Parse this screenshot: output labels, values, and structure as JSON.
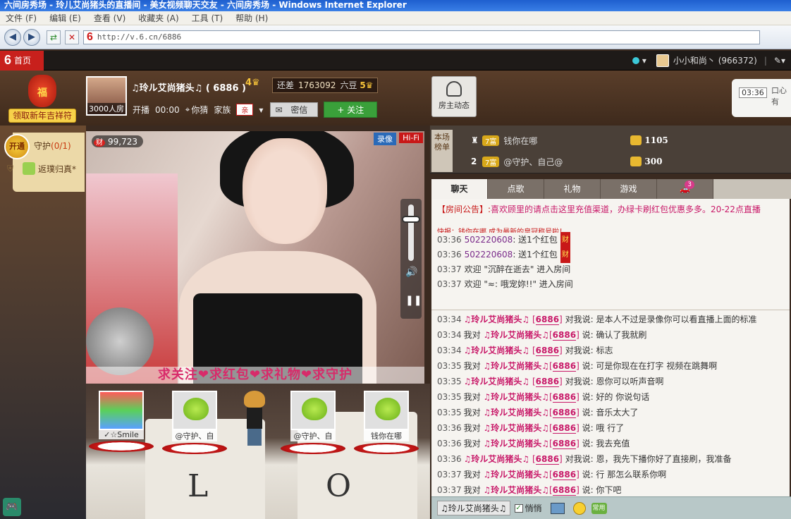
{
  "window": {
    "title": "六间房秀场 - 玲儿艾尚猪头的直播间 - 美女视频聊天交友 - 六间房秀场 - Windows Internet Explorer"
  },
  "menu": [
    "文件 (F)",
    "编辑 (E)",
    "查看 (V)",
    "收藏夹 (A)",
    "工具 (T)",
    "帮助 (H)"
  ],
  "address": {
    "url": "http://v.6.cn/6886",
    "logo": "6"
  },
  "site": {
    "home_logo": "6",
    "home_label": "首页",
    "user": "小小和尚丶 (966372)",
    "separator": "|"
  },
  "header": {
    "newyear_label": "领取新年吉祥符",
    "fu_char": "福",
    "host_photo_caption": "3000人房",
    "host_name": "♫玲ル艾尚猪头♫ ( 6886 )",
    "host_level": "4",
    "gap_label": "还差",
    "gap_value": "1763092",
    "gap_unit": "六豆",
    "next_level": "5",
    "live_label": "开播",
    "live_time": "00:00",
    "location": "你猜",
    "family_label": "家族",
    "family_badge": "亲",
    "message_button": "密信",
    "follow_button": "+ 关注",
    "dynamics_button": "房主动态",
    "clock_time": "03:36",
    "clock_note": "口心有"
  },
  "guard": {
    "open_label": "开通",
    "title": "守护",
    "count": "(0/1)",
    "member": "返璞归真*"
  },
  "video": {
    "wealth_icon": "财",
    "wealth_count": "99,723",
    "record_label": "录像",
    "hifi_label": "Hi-Fi",
    "slogan": "求关注❤求红包❤求礼物❤求守护"
  },
  "seats": [
    {
      "name": "✓☆Smile"
    },
    {
      "name": "@守护、自"
    },
    {
      "name": "@守护、自"
    },
    {
      "name": "钱你在哪"
    }
  ],
  "cube_letters": [
    "L",
    "O"
  ],
  "ranking": {
    "tag": "本场榜单",
    "rows": [
      {
        "rank": "",
        "vip": "7富",
        "name": "钱你在哪",
        "coins": "1105"
      },
      {
        "rank": "2",
        "vip": "7富",
        "name": "@守护、自己@",
        "coins": "300"
      }
    ]
  },
  "tabs": [
    {
      "label": "聊天",
      "active": true
    },
    {
      "label": "点歌"
    },
    {
      "label": "礼物"
    },
    {
      "label": "游戏"
    },
    {
      "label": "",
      "count": "3"
    }
  ],
  "notice": {
    "tag": "【房间公告】:",
    "text": "喜欢顾里的请点击这里充值渠道，办绿卡刷红包优惠多多。20-22点直播"
  },
  "system_cut_line": "快报：钱你在哪 成为最新的皇冠称号啦！",
  "system_messages": [
    {
      "time": "03:36",
      "uid": "502220608",
      "text": ": 送1个红包",
      "badge": "财"
    },
    {
      "time": "03:36",
      "uid": "502220608",
      "text": ": 送1个红包",
      "badge": "财"
    },
    {
      "time": "03:37",
      "uid": "",
      "text": "欢迎  \"沉醉在逝去\" 进入房间",
      "badge": ""
    },
    {
      "time": "03:37",
      "uid": "",
      "text": "欢迎  \"≈: 哦宠妳!!\" 进入房间",
      "badge": ""
    }
  ],
  "chat_messages": [
    {
      "time": "03:34",
      "from": "♫玲ル艾尚猪头♫",
      "rid": "6886",
      "dir": "对我说",
      "text": "是本人不过是录像你可以看直播上面的标准",
      "me_first": false
    },
    {
      "time": "03:34",
      "from": "我对",
      "to": "♫玲ル艾尚猪头♫",
      "rid": "6886",
      "text": "说: 确认了我就刷",
      "me_first": true
    },
    {
      "time": "03:34",
      "from": "♫玲ル艾尚猪头♫",
      "rid": "6886",
      "dir": "对我说",
      "text": "标志",
      "me_first": false
    },
    {
      "time": "03:35",
      "from": "我对",
      "to": "♫玲ル艾尚猪头♫",
      "rid": "6886",
      "text": "说: 可是你现在在打字 视频在跳舞啊",
      "me_first": true
    },
    {
      "time": "03:35",
      "from": "♫玲ル艾尚猪头♫",
      "rid": "6886",
      "dir": "对我说",
      "text": "恩你可以听声音啊",
      "me_first": false
    },
    {
      "time": "03:35",
      "from": "我对",
      "to": "♫玲ル艾尚猪头♫",
      "rid": "6886",
      "text": "说: 好的 你说句话",
      "me_first": true
    },
    {
      "time": "03:35",
      "from": "我对",
      "to": "♫玲ル艾尚猪头♫",
      "rid": "6886",
      "text": "说: 音乐太大了",
      "me_first": true
    },
    {
      "time": "03:36",
      "from": "我对",
      "to": "♫玲ル艾尚猪头♫",
      "rid": "6886",
      "text": "说: 哦 行了",
      "me_first": true
    },
    {
      "time": "03:36",
      "from": "我对",
      "to": "♫玲ル艾尚猪头♫",
      "rid": "6886",
      "text": "说: 我去充值",
      "me_first": true
    },
    {
      "time": "03:36",
      "from": "♫玲ル艾尚猪头♫",
      "rid": "6886",
      "dir": "对我说",
      "text": "恩，我先下播你好了直接刷，我准备",
      "me_first": false
    },
    {
      "time": "03:37",
      "from": "我对",
      "to": "♫玲ル艾尚猪头♫",
      "rid": "6886",
      "text": "说: 行 那怎么联系你啊",
      "me_first": true
    },
    {
      "time": "03:37",
      "from": "我对",
      "to": "♫玲ル艾尚猪头♫",
      "rid": "6886",
      "text": "说: 你下吧",
      "me_first": true
    }
  ],
  "input": {
    "target": "♫玲ル艾尚猪头♫",
    "whisper_label": "悄悄",
    "phrase_label": "常用"
  }
}
